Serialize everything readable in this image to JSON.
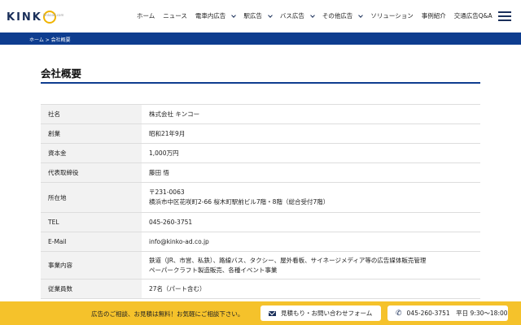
{
  "header": {
    "logo_text": "KINK",
    "logo_sub": "kinkoad.com",
    "nav": [
      {
        "label": "ホーム",
        "dropdown": false
      },
      {
        "label": "ニュース",
        "dropdown": false
      },
      {
        "label": "電車内広告",
        "dropdown": true
      },
      {
        "label": "駅広告",
        "dropdown": true
      },
      {
        "label": "バス広告",
        "dropdown": true
      },
      {
        "label": "その他広告",
        "dropdown": true
      },
      {
        "label": "ソリューション",
        "dropdown": false
      },
      {
        "label": "事例紹介",
        "dropdown": false
      },
      {
        "label": "交通広告Q&A",
        "dropdown": false
      }
    ]
  },
  "breadcrumb": "ホーム > 会社概要",
  "page_title": "会社概要",
  "company_table": [
    {
      "label": "社名",
      "lines": [
        "株式会社 キンコー"
      ]
    },
    {
      "label": "創業",
      "lines": [
        "昭和21年9月"
      ]
    },
    {
      "label": "資本金",
      "lines": [
        "1,000万円"
      ]
    },
    {
      "label": "代表取締役",
      "lines": [
        "藤田 悟"
      ]
    },
    {
      "label": "所在地",
      "lines": [
        "〒231-0063",
        "横浜市中区花咲町2-66 桜木町駅前ビル7階・8階（総合受付7階）"
      ]
    },
    {
      "label": "TEL",
      "lines": [
        "045-260-3751"
      ]
    },
    {
      "label": "E-Mail",
      "lines": [
        "info@kinko-ad.co.jp"
      ]
    },
    {
      "label": "事業内容",
      "lines": [
        "鉄道（JR、市営、私鉄）、路線バス、タクシー、屋外看板、サイネージメディア等の広告媒体販売管理",
        "ペーパークラフト製造販売、各種イベント事業"
      ]
    },
    {
      "label": "従業員数",
      "lines": [
        "27名（パート含む）"
      ]
    }
  ],
  "cta": {
    "text": "広告のご相談、お見積は無料！お気軽にご相談下さい。",
    "mail_button": "見積もり・お問い合わせフォーム",
    "tel_button": "045-260-3751　平日 9:30〜18:00"
  },
  "colors": {
    "brand_navy": "#0e3d8f",
    "cta_yellow": "#f5c22b",
    "row_header_bg": "#f2f2f2"
  }
}
